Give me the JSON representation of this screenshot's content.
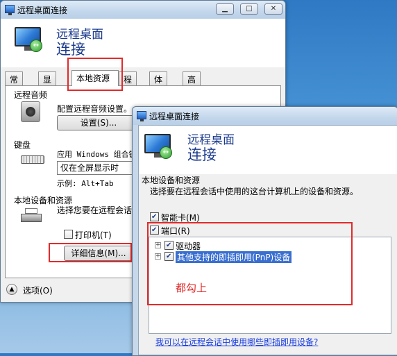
{
  "back_window": {
    "title": "远程桌面连接",
    "banner_line1": "远程桌面",
    "banner_line2": "连接",
    "tabs": [
      "常规",
      "显示",
      "本地资源",
      "程序",
      "体验",
      "高级"
    ],
    "active_tab": "本地资源",
    "audio": {
      "group_title": "远程音频",
      "description": "配置远程音频设置。",
      "settings_button": "设置(S)..."
    },
    "keyboard": {
      "group_title": "键盘",
      "description": "应用 Windows 组合键",
      "selected_option": "仅在全屏显示时",
      "example": "示例: Alt+Tab"
    },
    "local_devices": {
      "group_title": "本地设备和资源",
      "description": "选择您要在远程会话",
      "printer_label": "打印机(T)",
      "printer_checked": false,
      "details_button": "详细信息(M)..."
    },
    "options_label": "选项(O)"
  },
  "front_window": {
    "title": "远程桌面连接",
    "banner_line1": "远程桌面",
    "banner_line2": "连接",
    "section_title": "本地设备和资源",
    "instruction": "选择要在远程会话中使用的这台计算机上的设备和资源。",
    "smart_card_label": "智能卡(M)",
    "smart_card_checked": true,
    "ports_label": "端口(R)",
    "ports_checked": true,
    "tree_items": [
      {
        "label": "驱动器",
        "checked": true
      },
      {
        "label": "其他支持的即插即用(PnP)设备",
        "checked": true
      }
    ],
    "annotation": "都勾上",
    "help_link": "我可以在远程会话中使用哪些即插即用设备?"
  },
  "colors": {
    "annotation_red": "#e22a2a",
    "banner_text": "#1b3a8c",
    "link_blue": "#1a3ee0"
  }
}
